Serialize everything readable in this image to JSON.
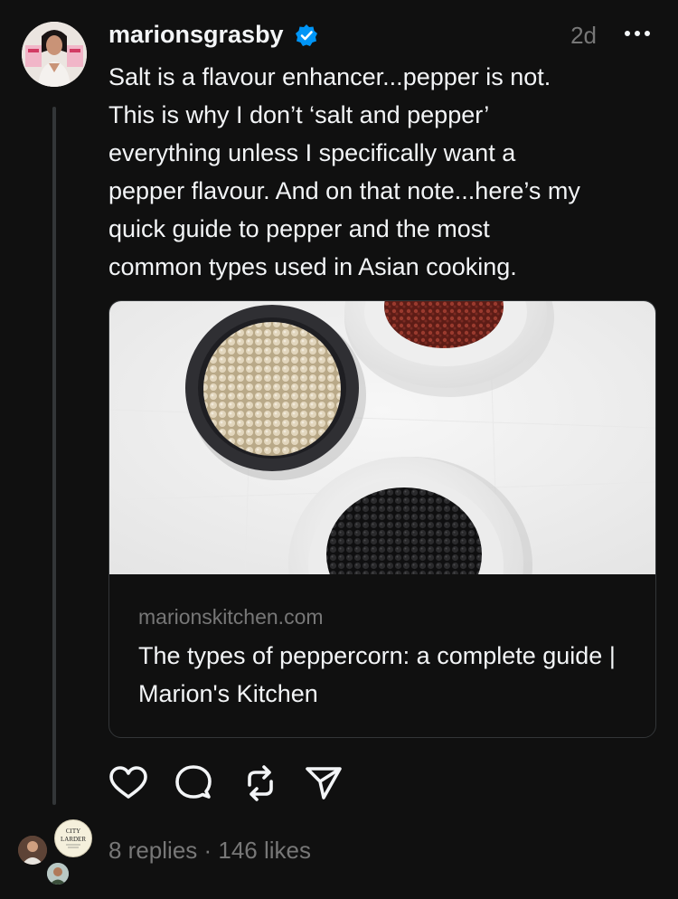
{
  "post": {
    "username": "marionsgrasby",
    "time": "2d",
    "text": "Salt is a flavour enhancer...pepper is not.\nThis is why I don’t ‘salt and pepper’\neverything unless I specifically want a\npepper flavour. And on that note...here’s my\nquick guide to pepper and the most\ncommon types used in Asian cooking.",
    "verified_icon": "verified-badge-icon",
    "more_icon": "more-options-icon"
  },
  "link_card": {
    "domain": "marionskitchen.com",
    "title": "The types of peppercorn: a complete guide | Marion's Kitchen"
  },
  "actions": [
    "like-icon",
    "comment-icon",
    "repost-icon",
    "share-icon"
  ],
  "stats": {
    "text": "8 replies · 146 likes"
  },
  "replier_logo": {
    "line1": "CITY",
    "line2": "LARDER"
  },
  "colors": {
    "background": "#101010",
    "primary_text": "#f3f5f7",
    "secondary_text": "#777777",
    "border": "#333638",
    "verified": "#0095f6"
  }
}
